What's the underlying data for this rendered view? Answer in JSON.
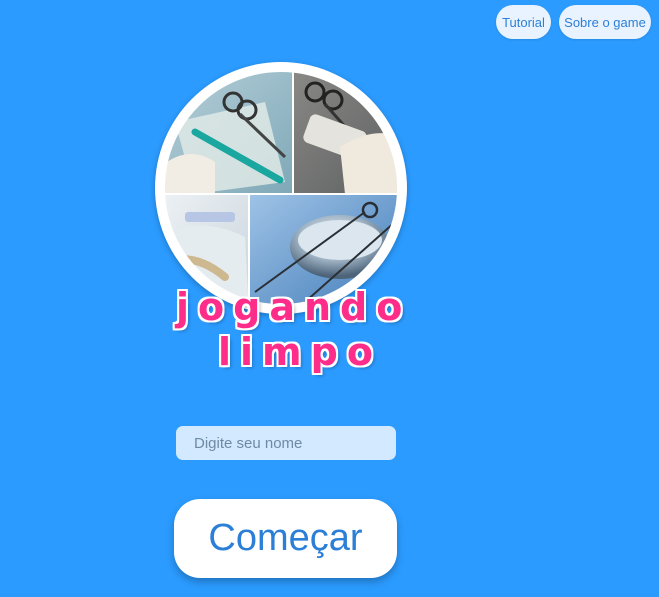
{
  "topnav": {
    "tutorial_label": "Tutorial",
    "sobre_label": "Sobre o game"
  },
  "logo": {
    "line1": "jogando",
    "line2": "limpo",
    "text_color": "#ff2d8a"
  },
  "name_input": {
    "placeholder": "Digite seu nome",
    "value": ""
  },
  "start_button": {
    "label": "Começar"
  },
  "colors": {
    "background": "#2b9bff",
    "button_text": "#2b7fd6",
    "input_bg": "#d3e9ff"
  }
}
